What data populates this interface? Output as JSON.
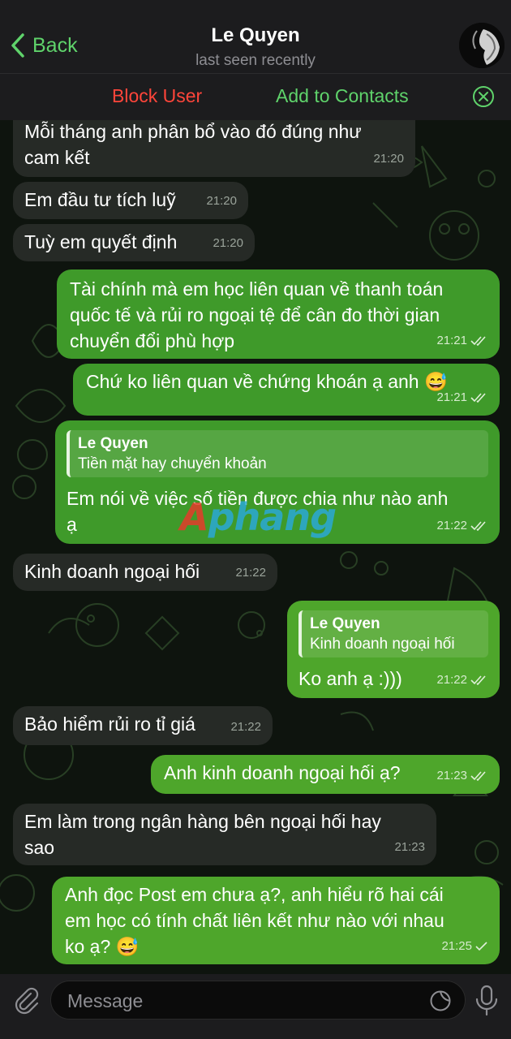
{
  "header": {
    "back_label": "Back",
    "contact_name": "Le Quyen",
    "status": "last seen recently",
    "block_label": "Block User",
    "add_label": "Add to Contacts"
  },
  "messages": [
    {
      "dir": "in",
      "text": "Mỗi tháng anh phân bổ vào đó đúng như\ncam kết",
      "time": "21:20"
    },
    {
      "dir": "in",
      "text": "Em đầu tư tích luỹ",
      "time": "21:20"
    },
    {
      "dir": "in",
      "text": "Tuỳ em quyết định",
      "time": "21:20"
    },
    {
      "dir": "out",
      "text": "Tài chính mà em học liên quan về thanh toán\nquốc tế và rủi ro ngoại tệ để cân đo thời gian\nchuyển đổi phù hợp",
      "time": "21:21"
    },
    {
      "dir": "out",
      "text": "Chứ ko liên quan về chứng khoán ạ anh 😅",
      "time": "21:21"
    },
    {
      "dir": "out",
      "reply_name": "Le Quyen",
      "reply_text": "Tiền mặt hay chuyển khoản",
      "text": "Em nói về việc số tiền được chia như nào anh\nạ",
      "time": "21:22"
    },
    {
      "dir": "in",
      "text": "Kinh doanh ngoại hối",
      "time": "21:22"
    },
    {
      "dir": "out",
      "reply_name": "Le Quyen",
      "reply_text": "Kinh doanh ngoại hối",
      "text": "Ko anh ạ :)))",
      "time": "21:22"
    },
    {
      "dir": "in",
      "text": "Bảo hiểm rủi ro tỉ giá",
      "time": "21:22"
    },
    {
      "dir": "out",
      "text": "Anh kinh doanh ngoại hối ạ?",
      "time": "21:23"
    },
    {
      "dir": "in",
      "text": "Em làm trong ngân hàng bên ngoại hối hay\nsao",
      "time": "21:23"
    },
    {
      "dir": "out",
      "text": "Anh đọc Post em chưa ạ?, anh hiểu rõ hai cái\nem học có tính chất liên kết như nào với nhau\nko ạ? 😅",
      "time": "21:25"
    }
  ],
  "watermark": {
    "first": "A",
    "rest": "phang"
  },
  "input": {
    "placeholder": "Message"
  },
  "colors": {
    "accent": "#5fd36b",
    "danger": "#ff453a",
    "incoming": "#262a26",
    "outgoing": "#3f9a2a"
  }
}
